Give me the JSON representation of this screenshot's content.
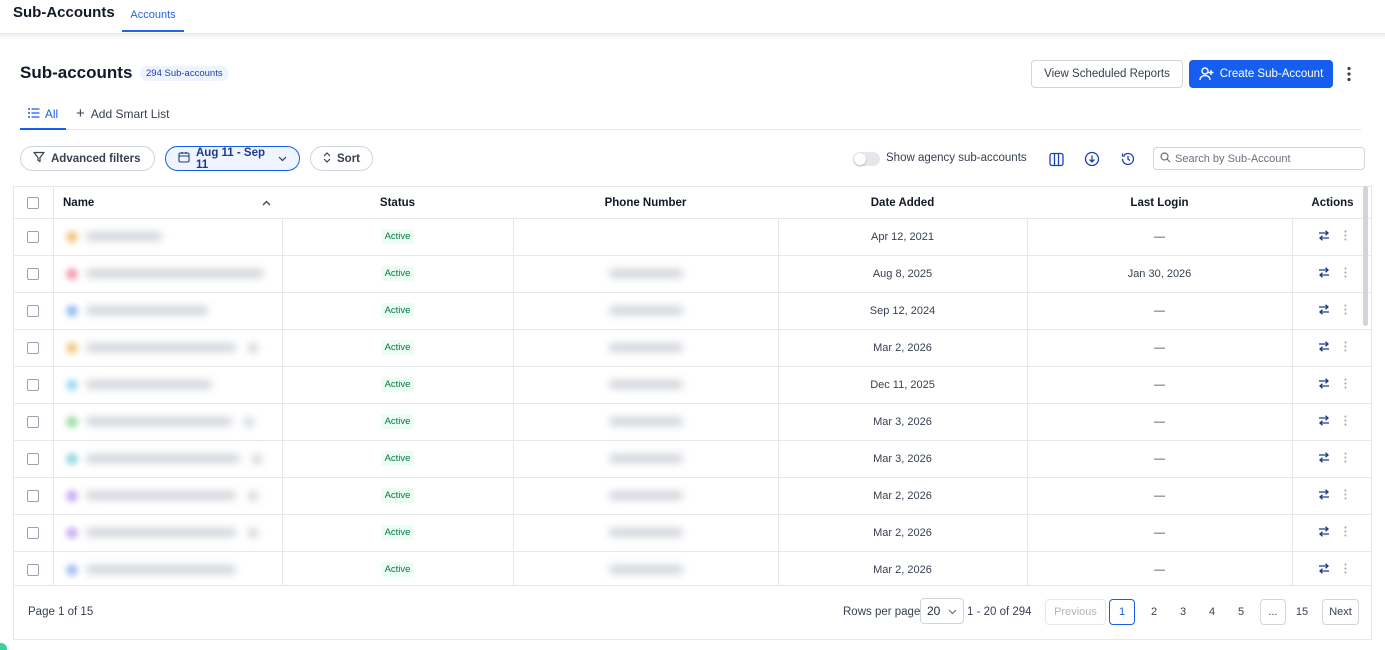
{
  "topbar": {
    "app_title": "Sub-Accounts",
    "tab_label": "Accounts"
  },
  "header": {
    "title": "Sub-accounts",
    "count_badge": "294 Sub-accounts",
    "view_reports_label": "View Scheduled Reports",
    "create_label": "Create Sub-Account"
  },
  "tabs": {
    "all_label": "All",
    "add_smart_list_label": "Add Smart List"
  },
  "filters": {
    "advanced_label": "Advanced filters",
    "date_range_label": "Aug 11 - Sep 11",
    "sort_label": "Sort",
    "toggle_label": "Show agency sub-accounts",
    "search_placeholder": "Search by Sub-Account"
  },
  "table": {
    "columns": [
      "Name",
      "Status",
      "Phone Number",
      "Date Added",
      "Last Login",
      "Actions"
    ],
    "rows": [
      {
        "status": "Active",
        "date_added": "Apr 12, 2021",
        "last_login": "—",
        "avatar_color": "#f5c98a",
        "name_width": 76,
        "has_phone": false,
        "has_tag": false
      },
      {
        "status": "Active",
        "date_added": "Aug 8, 2025",
        "last_login": "Jan 30, 2026",
        "avatar_color": "#f4a3b5",
        "name_width": 178,
        "has_phone": true,
        "has_tag": false
      },
      {
        "status": "Active",
        "date_added": "Sep 12, 2024",
        "last_login": "—",
        "avatar_color": "#9ec1f5",
        "name_width": 122,
        "has_phone": true,
        "has_tag": false
      },
      {
        "status": "Active",
        "date_added": "Mar 2, 2026",
        "last_login": "—",
        "avatar_color": "#f5cf8e",
        "name_width": 150,
        "has_phone": true,
        "has_tag": true
      },
      {
        "status": "Active",
        "date_added": "Dec 11, 2025",
        "last_login": "—",
        "avatar_color": "#a7dff0",
        "name_width": 126,
        "has_phone": true,
        "has_tag": false
      },
      {
        "status": "Active",
        "date_added": "Mar 3, 2026",
        "last_login": "—",
        "avatar_color": "#a8e0b0",
        "name_width": 146,
        "has_phone": true,
        "has_tag": true
      },
      {
        "status": "Active",
        "date_added": "Mar 3, 2026",
        "last_login": "—",
        "avatar_color": "#9fd9e0",
        "name_width": 154,
        "has_phone": true,
        "has_tag": true
      },
      {
        "status": "Active",
        "date_added": "Mar 2, 2026",
        "last_login": "—",
        "avatar_color": "#c6b3f2",
        "name_width": 150,
        "has_phone": true,
        "has_tag": true
      },
      {
        "status": "Active",
        "date_added": "Mar 2, 2026",
        "last_login": "—",
        "avatar_color": "#cdb7f3",
        "name_width": 150,
        "has_phone": true,
        "has_tag": true
      },
      {
        "status": "Active",
        "date_added": "Mar 2, 2026",
        "last_login": "—",
        "avatar_color": "#a9c4f3",
        "name_width": 150,
        "has_phone": true,
        "has_tag": false
      }
    ]
  },
  "footer": {
    "page_info": "Page 1 of 15",
    "rows_per_page_label": "Rows per page",
    "rows_per_page_value": "20",
    "range": "1 - 20 of 294",
    "previous_label": "Previous",
    "pages": [
      "1",
      "2",
      "3",
      "4",
      "5",
      "...",
      "15"
    ],
    "current_page": "1",
    "next_label": "Next"
  },
  "colors": {
    "primary": "#155eef",
    "active_status": "#067647",
    "border": "#e5e7eb"
  }
}
